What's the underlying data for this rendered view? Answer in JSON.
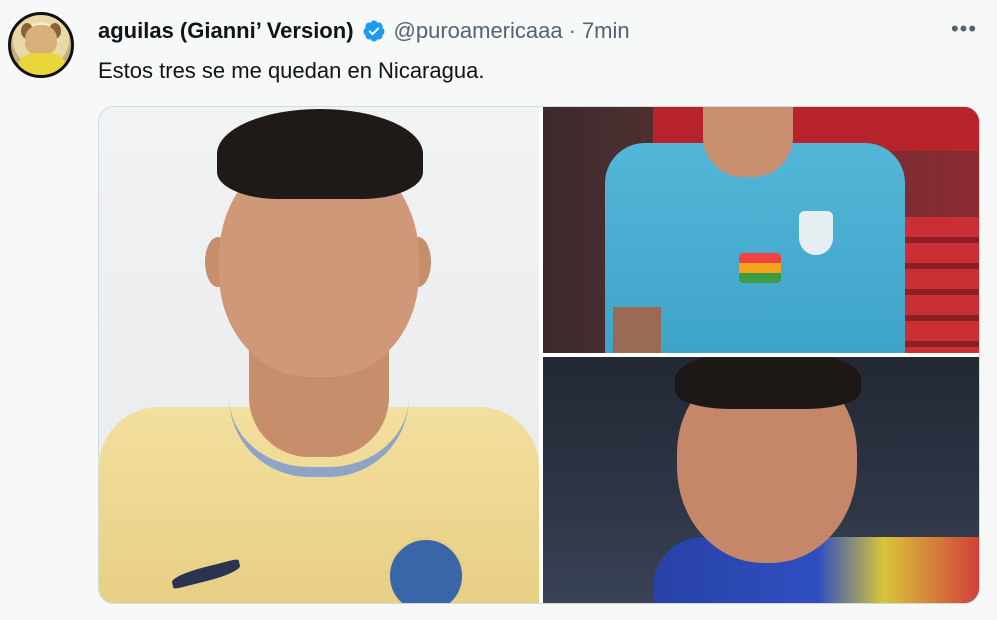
{
  "tweet": {
    "display_name": "aguilas (Gianni’ Version)",
    "handle": "@puroamericaaa",
    "separator": "·",
    "time": "7min",
    "more_label": "•••",
    "text": "Estos tres se me quedan en Nicaragua.",
    "verified_color": "#1d9bf0"
  },
  "media": {
    "images": [
      {
        "name": "player-photo-left",
        "description_icon": "photo-icon"
      },
      {
        "name": "player-photo-top-right",
        "description_icon": "photo-icon"
      },
      {
        "name": "player-photo-bottom-right",
        "description_icon": "photo-icon"
      }
    ]
  }
}
